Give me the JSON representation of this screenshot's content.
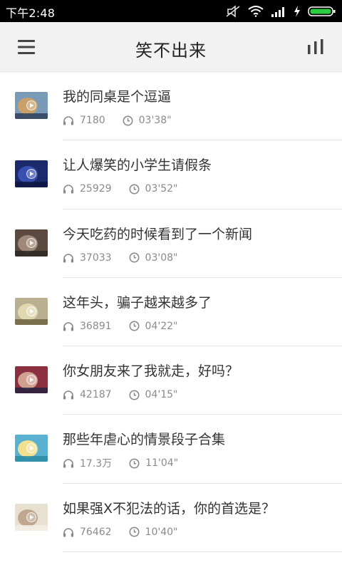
{
  "status_bar": {
    "time": "下午2:48",
    "icons": [
      "silent-icon",
      "wifi-icon",
      "signal-icon",
      "charging-icon",
      "battery-icon"
    ]
  },
  "toolbar": {
    "title": "笑不出来",
    "menu_icon": "hamburger-menu-icon",
    "stats_icon": "bar-chart-icon"
  },
  "colors": {
    "status_bar_bg": "#000000",
    "toolbar_bg": "#f2f2f2",
    "meta_text": "#8a8a8a",
    "battery_green": "#2ecc40"
  },
  "items": [
    {
      "title": "我的同桌是个逗逼",
      "plays": "7180",
      "duration": "03'38\"",
      "thumb_colors": [
        "#7a9bb8",
        "#c9a06a",
        "#2b3b55"
      ]
    },
    {
      "title": "让人爆笑的小学生请假条",
      "plays": "25929",
      "duration": "03'52\"",
      "thumb_colors": [
        "#1a2a6a",
        "#3850b0",
        "#0d1440"
      ]
    },
    {
      "title": "今天吃药的时候看到了一个新闻",
      "plays": "37033",
      "duration": "03'08\"",
      "thumb_colors": [
        "#5a4a40",
        "#a08878",
        "#2a2420"
      ]
    },
    {
      "title": "这年头，骗子越来越多了",
      "plays": "36891",
      "duration": "04'22\"",
      "thumb_colors": [
        "#b8b090",
        "#e0d8b0",
        "#6a6040"
      ]
    },
    {
      "title": "你女朋友来了我就走，好吗？",
      "plays": "42187",
      "duration": "04'15\"",
      "thumb_colors": [
        "#8a3040",
        "#d0a090",
        "#202040"
      ]
    },
    {
      "title": "那些年虐心的情景段子合集",
      "plays": "17.3万",
      "duration": "11'04\"",
      "thumb_colors": [
        "#5ab0d0",
        "#f0e090",
        "#2a8aa0"
      ]
    },
    {
      "title": "如果强X不犯法的话，你的首选是？",
      "plays": "76462",
      "duration": "10'40\"",
      "thumb_colors": [
        "#e8e0d0",
        "#c0a890",
        "#f4efe6"
      ]
    }
  ]
}
